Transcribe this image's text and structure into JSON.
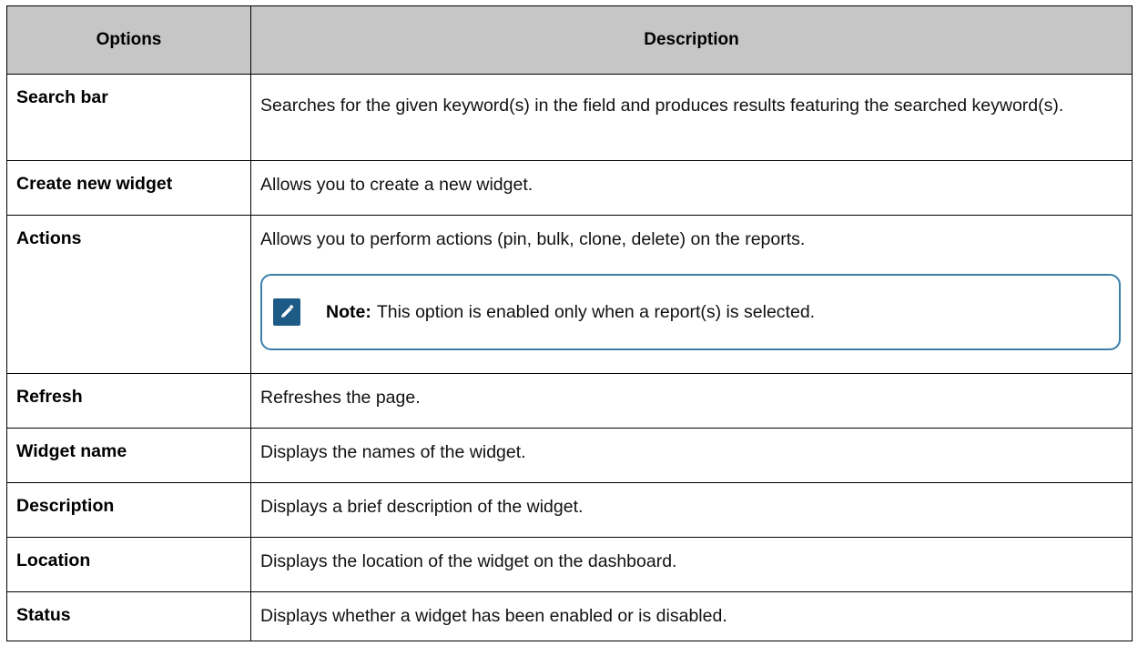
{
  "table": {
    "headers": [
      "Options",
      "Description"
    ],
    "rows": [
      {
        "option": "Search bar",
        "description": "Searches for the given keyword(s) in the field and produces results featuring the searched keyword(s)."
      },
      {
        "option": "Create new widget",
        "description": "Allows you to create a new widget."
      },
      {
        "option": "Actions",
        "description": "Allows you to perform actions (pin, bulk, clone, delete) on the reports.",
        "note": {
          "label": "Note:",
          "text": "This option is enabled only when a report(s) is selected.",
          "icon": "note-pencil-icon"
        }
      },
      {
        "option": "Refresh",
        "description": "Refreshes the page."
      },
      {
        "option": "Widget name",
        "description": "Displays the names of the widget."
      },
      {
        "option": "Description",
        "description": "Displays a brief description of the widget."
      },
      {
        "option": "Location",
        "description": "Displays the location of the widget on the dashboard."
      },
      {
        "option": "Status",
        "description": "Displays whether a widget has been enabled or is disabled."
      }
    ]
  },
  "colors": {
    "header_bg": "#c6c6c6",
    "note_border": "#3b7fa8",
    "note_icon_bg": "#1d5a86"
  }
}
